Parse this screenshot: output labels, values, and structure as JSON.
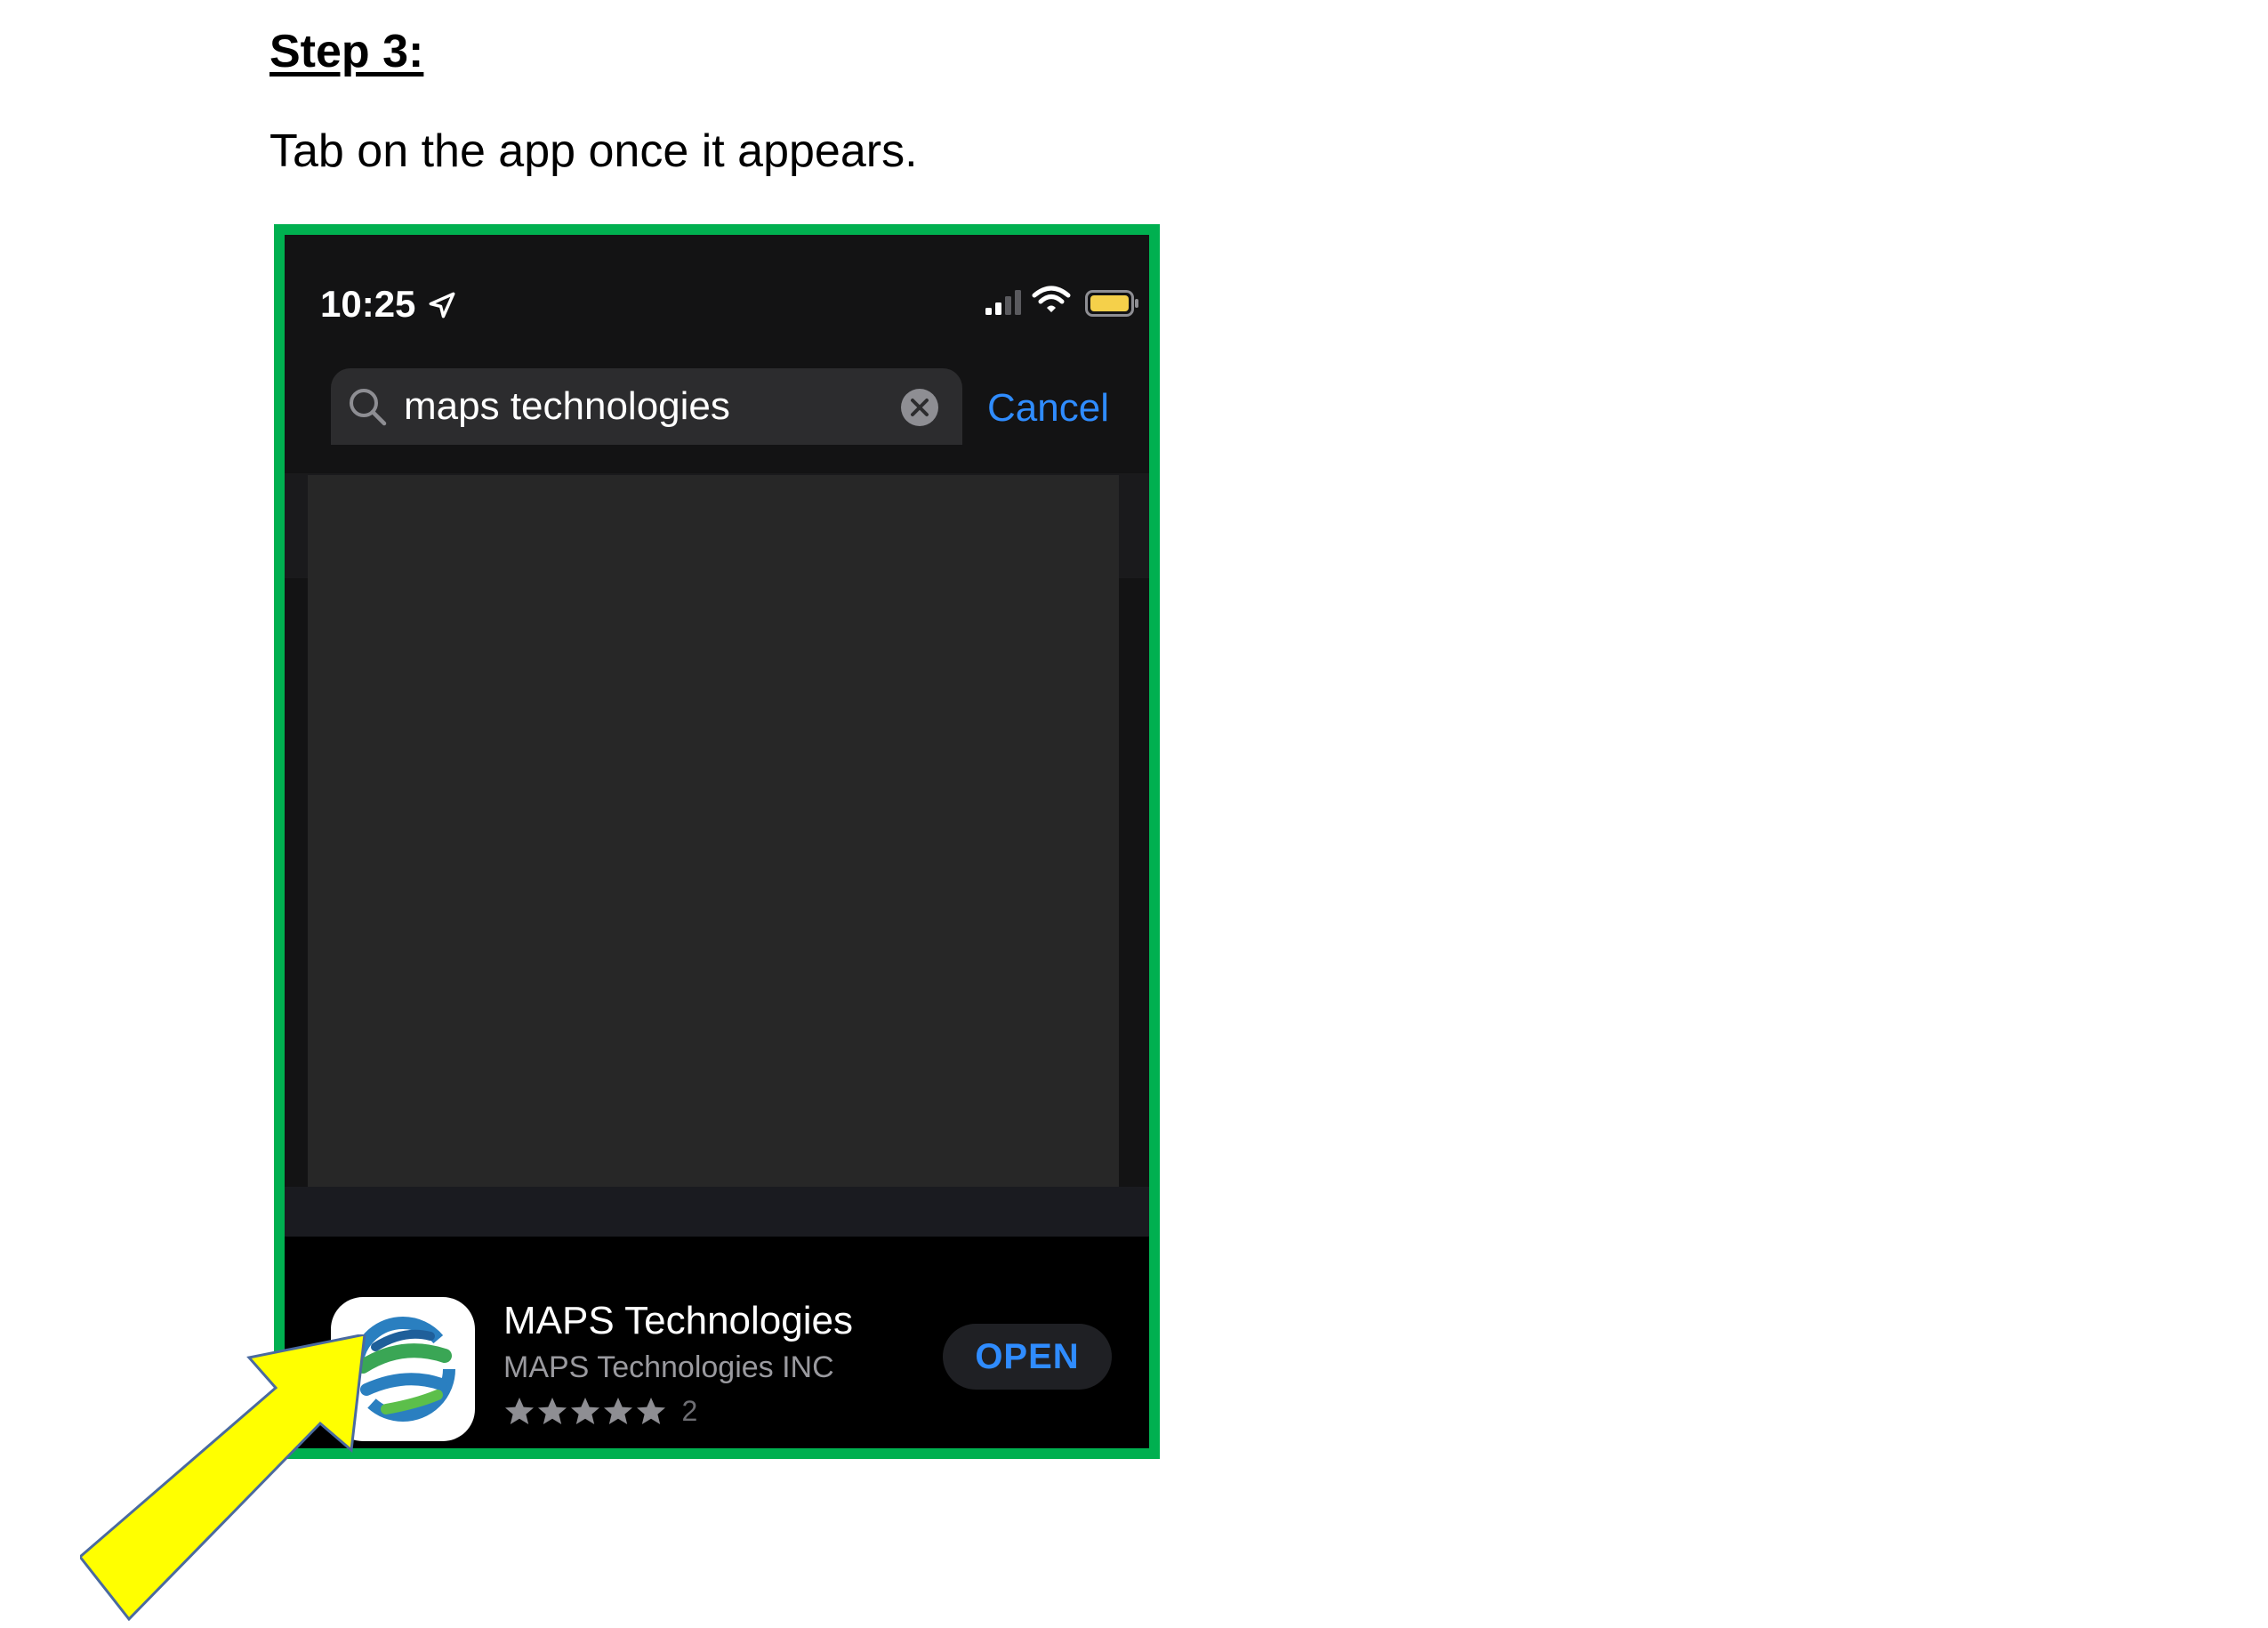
{
  "document": {
    "step_title": "Step 3:",
    "instruction": "Tab on the app once it appears."
  },
  "status_bar": {
    "time": "10:25",
    "icons": [
      "location-arrow-icon",
      "signal-bars-icon",
      "wifi-icon",
      "battery-icon"
    ]
  },
  "search": {
    "query": "maps technologies",
    "cancel_label": "Cancel"
  },
  "result": {
    "app_name": "MAPS Technologies",
    "developer": "MAPS Technologies INC",
    "rating_stars": 5,
    "rating_count": "2",
    "open_label": "OPEN"
  },
  "colors": {
    "frame_border": "#00b050",
    "accent_blue": "#2f8cff",
    "arrow_fill": "#ffff00"
  }
}
